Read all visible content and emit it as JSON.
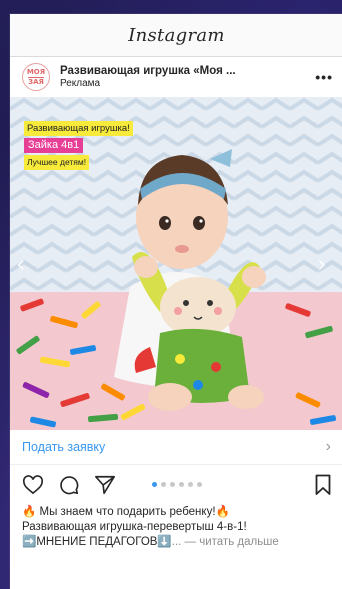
{
  "app": {
    "title": "Instagram"
  },
  "post": {
    "account_name": "Развивающая игрушка «Моя ...",
    "sponsored": "Реклама",
    "avatar_text": [
      "МОЯ",
      "ЗАЯ"
    ],
    "more_label": "•••",
    "image_labels": [
      "Развивающая игрушка!",
      "Зайка 4в1",
      "Лучшее детям!"
    ],
    "cta_label": "Подать заявку",
    "carousel": {
      "count": 6,
      "active_index": 0
    },
    "caption_line1": "🔥 Мы знаем что подарить ребенку!🔥",
    "caption_line2": "Развивающая игрушка-перевертыш 4-в-1!",
    "caption_line3": "➡️МНЕНИЕ ПЕДАГОГОВ⬇️",
    "caption_more": "... — читать дальше"
  },
  "icons": {
    "like": "heart-icon",
    "comment": "comment-icon",
    "share": "send-icon",
    "save": "bookmark-icon",
    "prev": "chevron-left-icon",
    "next": "chevron-right-icon"
  },
  "colors": {
    "link": "#3897f0",
    "label_yellow": "#f7ea3a",
    "label_pink": "#e83f96",
    "background": "#1c1848"
  }
}
